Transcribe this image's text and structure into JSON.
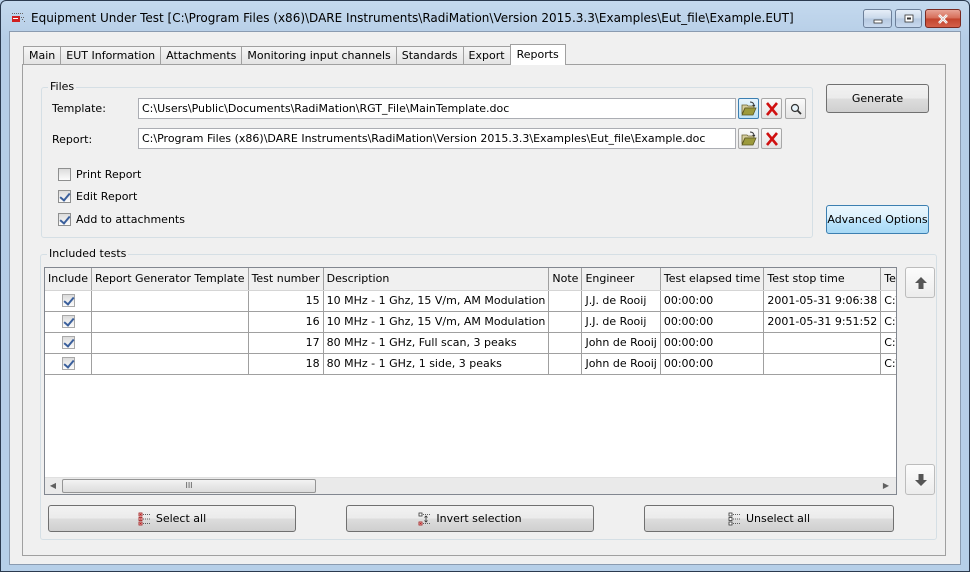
{
  "window": {
    "title": "Equipment Under Test [C:\\Program Files (x86)\\DARE Instruments\\RadiMation\\Version 2015.3.3\\Examples\\Eut_file\\Example.EUT]",
    "caption_buttons": {
      "minimize": "minimize-icon",
      "maximize": "maximize-icon",
      "close": "close-icon"
    }
  },
  "tabs": [
    {
      "label": "Main",
      "active": false
    },
    {
      "label": "EUT Information",
      "active": false
    },
    {
      "label": "Attachments",
      "active": false
    },
    {
      "label": "Monitoring input channels",
      "active": false
    },
    {
      "label": "Standards",
      "active": false
    },
    {
      "label": "Export",
      "active": false
    },
    {
      "label": "Reports",
      "active": true
    }
  ],
  "files": {
    "group_title": "Files",
    "template_label": "Template:",
    "template_value": "C:\\Users\\Public\\Documents\\RadiMation\\RGT_File\\MainTemplate.doc",
    "report_label": "Report:",
    "report_value": "C:\\Program Files (x86)\\DARE Instruments\\RadiMation\\Version 2015.3.3\\Examples\\Eut_file\\Example.doc",
    "options": [
      {
        "label": "Print Report",
        "checked": false
      },
      {
        "label": "Edit Report",
        "checked": true
      },
      {
        "label": "Add to attachments",
        "checked": true
      }
    ]
  },
  "actions": {
    "generate": "Generate",
    "advanced_options": "Advanced Options"
  },
  "included_tests": {
    "group_title": "Included tests",
    "columns": [
      "Include",
      "Report Generator Template",
      "Test number",
      "Description",
      "Note",
      "Engineer",
      "Test elapsed time",
      "Test stop time",
      "Test Filename"
    ],
    "rows": [
      {
        "include": true,
        "template": "",
        "test_number": "15",
        "description": "10 MHz - 1 Ghz, 15 V/m, AM Modulation",
        "note": "",
        "engineer": "J.J. de Rooij",
        "elapsed": "00:00:00",
        "stop_time": "2001-05-31 9:06:38",
        "filename": "C:\\Progra"
      },
      {
        "include": true,
        "template": "",
        "test_number": "16",
        "description": "10 MHz - 1 Ghz, 15 V/m, AM Modulation",
        "note": "",
        "engineer": "J.J. de Rooij",
        "elapsed": "00:00:00",
        "stop_time": "2001-05-31 9:51:52",
        "filename": "C:\\Progra"
      },
      {
        "include": true,
        "template": "",
        "test_number": "17",
        "description": "80 MHz - 1 GHz, Full scan, 3 peaks",
        "note": "",
        "engineer": "John de Rooij",
        "elapsed": "00:00:00",
        "stop_time": "",
        "filename": "C:\\Progra"
      },
      {
        "include": true,
        "template": "",
        "test_number": "18",
        "description": "80 MHz - 1 GHz, 1 side, 3 peaks",
        "note": "",
        "engineer": "John de Rooij",
        "elapsed": "00:00:00",
        "stop_time": "",
        "filename": "C:\\Progra"
      }
    ],
    "scroll_thumb_grip": "III",
    "select_all": "Select all",
    "invert_selection": "Invert selection",
    "unselect_all": "Unselect all",
    "move_up_icon": "arrow-up-icon",
    "move_down_icon": "arrow-down-icon"
  }
}
